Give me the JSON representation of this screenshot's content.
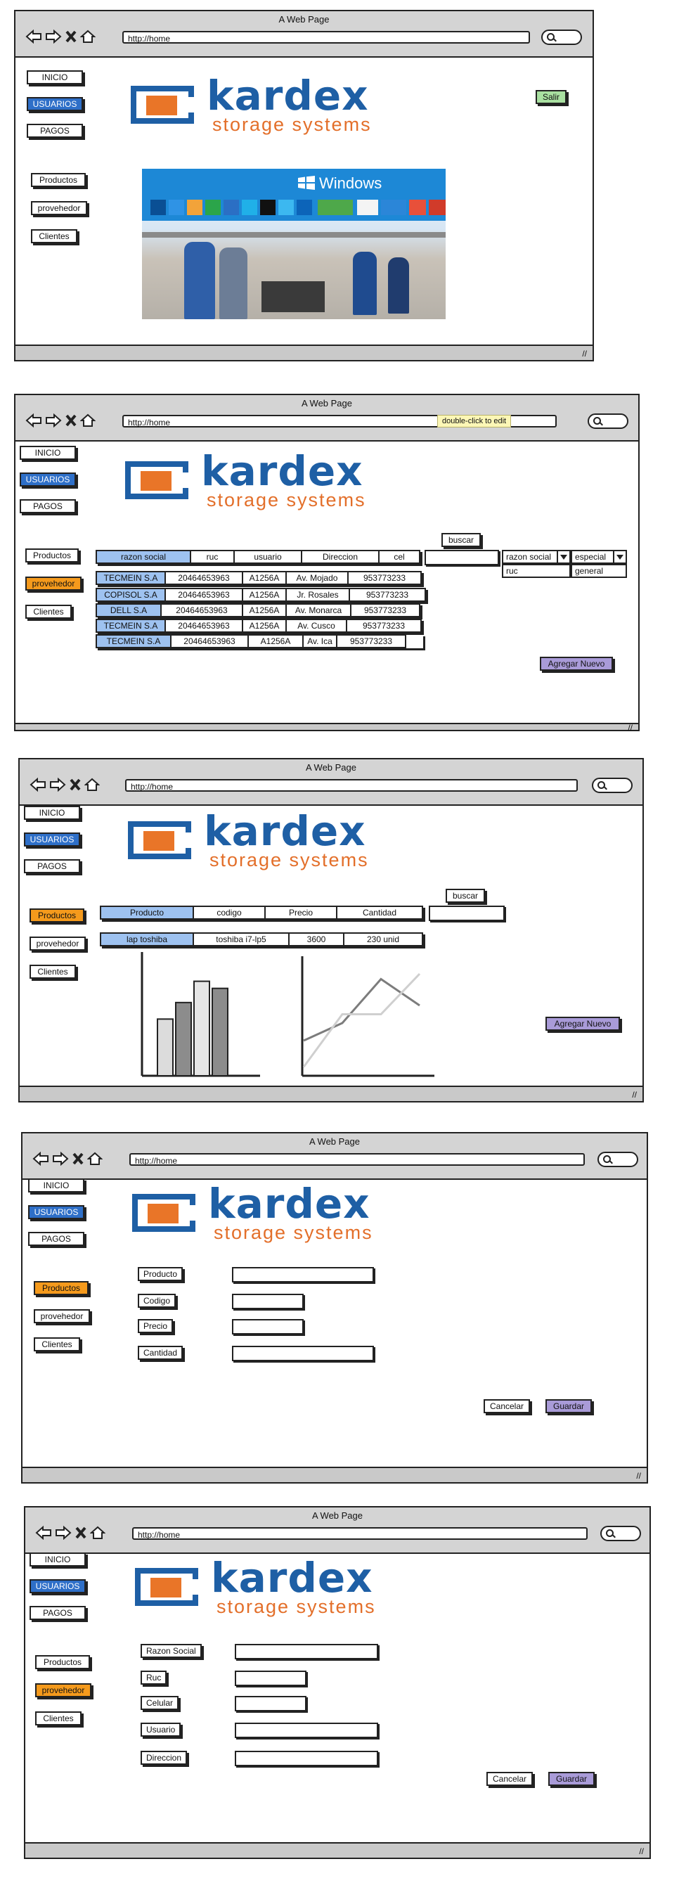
{
  "window": {
    "title": "A Web Page",
    "url": "http://home"
  },
  "menu": {
    "inicio": "INICIO",
    "usuarios": "USUARIOS",
    "pagos": "PAGOS",
    "productos": "Productos",
    "proveedor": "provehedor",
    "clientes": "Clientes",
    "salir": "Salir"
  },
  "logo": {
    "name": "kardex",
    "tagline": "storage systems"
  },
  "banner": {
    "brand": "Windows"
  },
  "tooltip": "double-click to edit",
  "proveedores": {
    "search_button": "buscar",
    "filter_1": {
      "selected": "razon social",
      "option": "ruc"
    },
    "filter_2": {
      "selected": "especial",
      "option": "general"
    },
    "columns": [
      "razon social",
      "ruc",
      "usuario",
      "Direccion",
      "cel"
    ],
    "rows": [
      [
        "TECMEIN S.A",
        "20464653963",
        "A1256A",
        "Av. Mojado",
        "953773233"
      ],
      [
        "COPISOL S.A",
        "20464653963",
        "A1256A",
        "Jr. Rosales",
        "953773233"
      ],
      [
        "DELL S.A",
        "20464653963",
        "A1256A",
        "Av. Monarca",
        "953773233"
      ],
      [
        "TECMEIN S.A",
        "20464653963",
        "A1256A",
        "Av. Cusco",
        "953773233"
      ],
      [
        "TECMEIN S.A",
        "20464653963",
        "A1256A",
        "Av. Ica",
        "953773233"
      ]
    ],
    "add_button": "Agregar Nuevo"
  },
  "productos": {
    "search_button": "buscar",
    "columns": [
      "Producto",
      "codigo",
      "Precio",
      "Cantidad"
    ],
    "row": [
      "lap toshiba",
      "toshiba i7-lp5",
      "3600",
      "230 unid"
    ],
    "add_button": "Agregar Nuevo"
  },
  "form_producto": {
    "labels": [
      "Producto",
      "Codigo",
      "Precio",
      "Cantidad"
    ],
    "cancel": "Cancelar",
    "save": "Guardar"
  },
  "form_proveedor": {
    "labels": [
      "Razon Social",
      "Ruc",
      "Celular",
      "Usuario",
      "Direccion"
    ],
    "cancel": "Cancelar",
    "save": "Guardar"
  },
  "colors": {
    "blue_nav": "#2e6fc8",
    "orange_active": "#f59a1c",
    "green_exit": "#a9e0a1",
    "purple_action": "#a99bd8",
    "table_header": "#9ec2f0",
    "logo_blue": "#1e5fa5",
    "logo_orange": "#e36f2a"
  },
  "chart_data": [
    {
      "type": "bar",
      "categories": [
        "",
        "",
        "",
        "",
        ""
      ],
      "values": [
        48,
        62,
        80,
        74,
        0
      ],
      "series_colors": [
        "#dcdcdc",
        "#8c8c8c",
        "#e6e6e6",
        "#8c8c8c"
      ]
    },
    {
      "type": "line",
      "series": [
        {
          "values": [
            20,
            30,
            55,
            40
          ]
        },
        {
          "values": [
            5,
            35,
            35,
            58
          ]
        }
      ]
    }
  ]
}
